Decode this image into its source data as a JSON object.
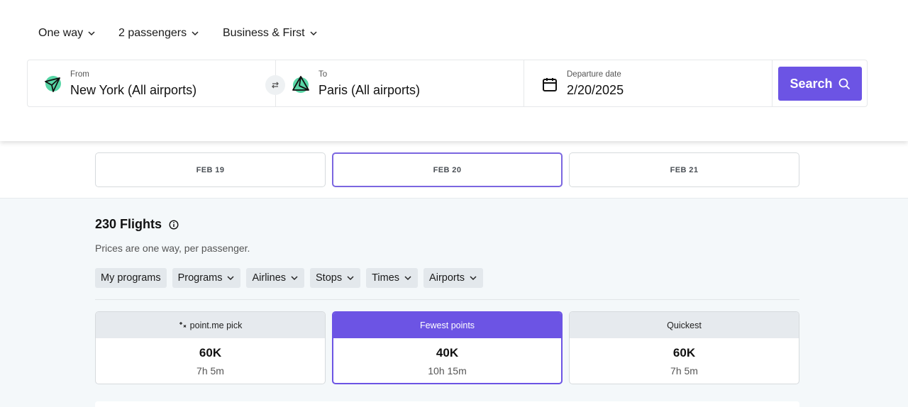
{
  "trip_options": {
    "trip_type": "One way",
    "passengers": "2 passengers",
    "cabin": "Business & First"
  },
  "search": {
    "from_label": "From",
    "from_value": "New York (All airports)",
    "to_label": "To",
    "to_value": "Paris (All airports)",
    "date_label": "Departure date",
    "date_value": "2/20/2025",
    "button_label": "Search"
  },
  "date_tabs": [
    {
      "label": "FEB 19",
      "active": false
    },
    {
      "label": "FEB 20",
      "active": true
    },
    {
      "label": "FEB 21",
      "active": false
    }
  ],
  "results": {
    "title": "230 Flights",
    "subtitle": "Prices are one way, per passenger."
  },
  "filters": [
    "My programs",
    "Programs",
    "Airlines",
    "Stops",
    "Times",
    "Airports"
  ],
  "summary_cards": [
    {
      "label": "point.me pick",
      "points": "60K",
      "duration": "7h 5m"
    },
    {
      "label": "Fewest points",
      "points": "40K",
      "duration": "10h 15m"
    },
    {
      "label": "Quickest",
      "points": "60K",
      "duration": "7h 5m"
    }
  ],
  "colors": {
    "accent": "#6c54e4",
    "icon_green": "#58d6a6",
    "page_bg": "#f4f8fa"
  }
}
